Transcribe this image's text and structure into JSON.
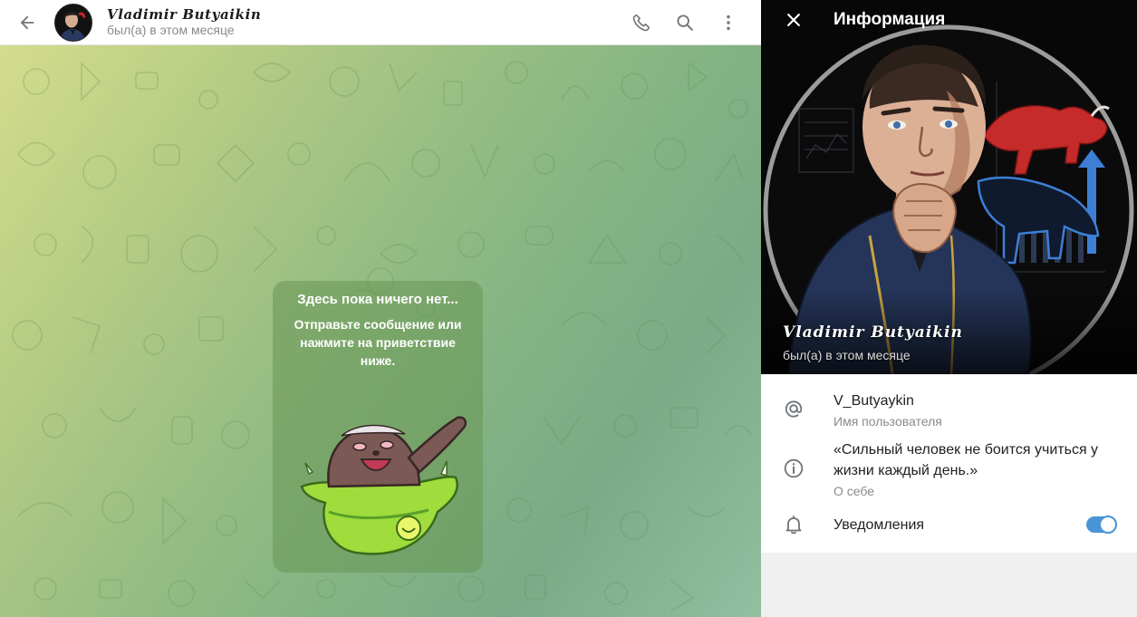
{
  "chat": {
    "contact_name": "Vladimir Butyaikin",
    "contact_status": "был(а) в этом месяце",
    "empty_title": "Здесь пока ничего нет...",
    "empty_text": "Отправьте сообщение или нажмите на приветствие ниже."
  },
  "panel": {
    "title": "Информация",
    "profile_name": "Vladimir Butyaikin",
    "profile_status": "был(а) в этом месяце",
    "username": "V_Butyaykin",
    "username_label": "Имя пользователя",
    "bio": "«Сильный человек не боится учиться у жизни каждый день.»",
    "bio_label": "О себе",
    "notifications_label": "Уведомления",
    "notifications_enabled": true
  },
  "icons": {
    "back": "arrow-left-icon",
    "call": "phone-icon",
    "search": "search-icon",
    "more": "more-vertical-icon",
    "close": "close-icon",
    "username": "at-sign-icon",
    "bio": "info-icon",
    "notifications": "bell-icon"
  },
  "colors": {
    "accent": "#4a95d6",
    "chat_background_start": "#d4dc8d",
    "chat_background_end": "#7aab86"
  }
}
